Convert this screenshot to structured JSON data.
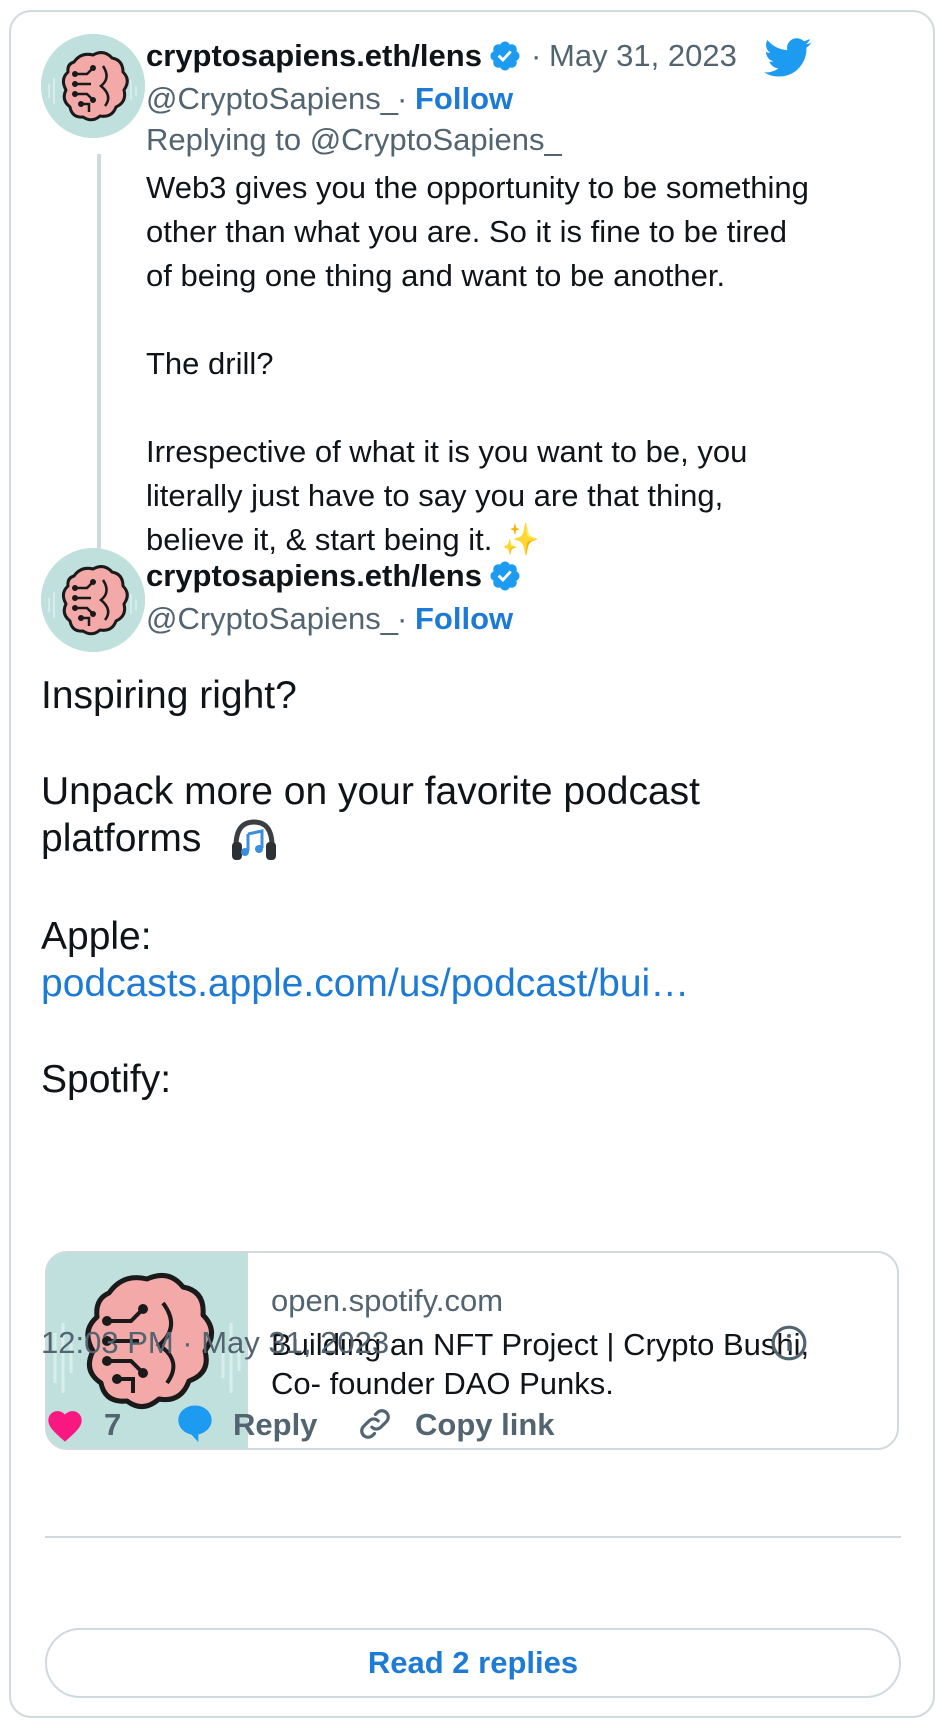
{
  "reply_tweet": {
    "display_name": "cryptosapiens.eth/lens",
    "handle": "@CryptoSapiens_",
    "dot": "·",
    "date": "May 31, 2023",
    "follow": "Follow",
    "replying_to": "Replying to @CryptoSapiens_",
    "text": "Web3 gives you the opportunity to be something\nother than what you are. So it is fine to be tired\nof being one thing and want to be another.\n\nThe drill?\n\nIrrespective of what it is you want to be, you\nliterally just have to say you are that thing,\nbelieve it, & start being it. ✨"
  },
  "main_tweet": {
    "display_name": "cryptosapiens.eth/lens",
    "handle": "@CryptoSapiens_",
    "dot": "·",
    "follow": "Follow",
    "line1": "Inspiring right?",
    "line2": "Unpack more on your favorite podcast",
    "line3": "platforms",
    "line4": "Apple:",
    "apple_link": "podcasts.apple.com/us/podcast/bui…",
    "line5": "Spotify:",
    "timestamp": "12:03 PM · May 31, 2023"
  },
  "link_card": {
    "domain": "open.spotify.com",
    "title_line1": "Building an NFT Project | Crypto Bushi,",
    "title_line2": "Co- founder DAO Punks."
  },
  "actions": {
    "like_count": "7",
    "reply_label": "Reply",
    "copy_label": "Copy link",
    "read_replies": "Read 2 replies"
  },
  "icons": {
    "brand": "twitter-bird-icon",
    "verified": "verified-badge-icon",
    "emoji_sparkles": "sparkles-icon",
    "emoji_headphones": "headphones-icon",
    "info": "info-icon",
    "heart": "heart-icon",
    "reply": "reply-bubble-icon",
    "link": "link-icon"
  },
  "colors": {
    "accent": "#1d7bd6",
    "twitter_blue": "#1d9bf0",
    "like_pink": "#f91880",
    "secondary_text": "#536471",
    "border": "#cfd9de",
    "avatar_bg": "#bfe0dc",
    "brain_fill": "#f4a9a9"
  }
}
